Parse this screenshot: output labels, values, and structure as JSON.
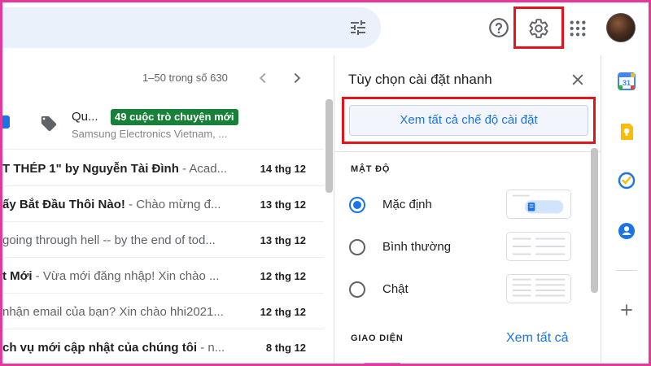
{
  "header": {
    "icons": [
      "search-options-icon",
      "help-icon",
      "gear-icon",
      "apps-grid-icon",
      "avatar"
    ]
  },
  "pagination": {
    "range": "1–50 trong số 630"
  },
  "promotions": {
    "title": "Qu...",
    "badge": "49 cuộc trò chuyện mới",
    "sender": "Samsung Electronics Vietnam, ..."
  },
  "emails": [
    {
      "subject": "T THÉP 1\" by Nguyễn Tài Đình",
      "snippet": " - Acad...",
      "date": "14 thg 12"
    },
    {
      "subject": "ấy Bắt Đầu Thôi Nào!",
      "snippet": " - Chào mừng đ...",
      "date": "13 thg 12"
    },
    {
      "subject": "",
      "snippet": "going through hell -- by the end of tod...",
      "date": "13 thg 12"
    },
    {
      "subject": "t Mới",
      "snippet": " - Vừa mới đăng nhập! Xin chào ...",
      "date": "12 thg 12"
    },
    {
      "subject": "",
      "snippet": "nhận email của bạn? Xin chào hhi2021...",
      "date": "12 thg 12"
    },
    {
      "subject": "ch vụ mới cập nhật của chúng tôi",
      "snippet": " - n...",
      "date": "8 thg 12"
    }
  ],
  "quick_settings": {
    "title": "Tùy chọn cài đặt nhanh",
    "see_all_button": "Xem tất cả chế độ cài đặt",
    "density_heading": "MẬT ĐỘ",
    "density_options": [
      {
        "label": "Mặc định",
        "checked": true
      },
      {
        "label": "Bình thường",
        "checked": false
      },
      {
        "label": "Chật",
        "checked": false
      }
    ],
    "theme_heading": "GIAO DIỆN",
    "theme_link": "Xem tất cả"
  },
  "side_apps": [
    "calendar-icon",
    "keep-icon",
    "tasks-icon",
    "contacts-icon",
    "add-icon"
  ],
  "colors": {
    "accent": "#1a73e8",
    "highlight_border": "#e3141b",
    "frame": "#e6389a",
    "badge_green": "#188038"
  }
}
